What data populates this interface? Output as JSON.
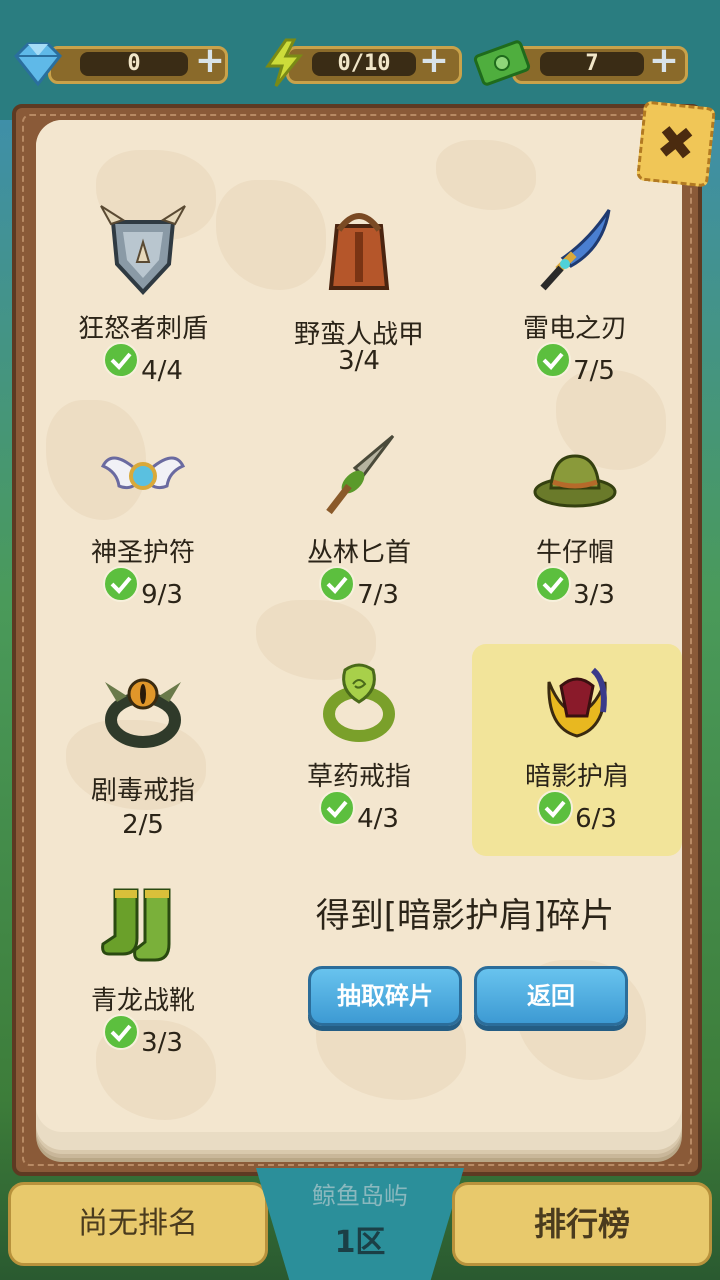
{
  "resources": [
    {
      "name": "diamond",
      "value": "0",
      "icon": "diamond-icon"
    },
    {
      "name": "energy",
      "value": "0/10",
      "icon": "lightning-icon"
    },
    {
      "name": "cash",
      "value": "7",
      "icon": "cash-icon"
    }
  ],
  "close_label": "✖",
  "items": [
    {
      "name": "狂怒者刺盾",
      "count": "4/4",
      "checked": true,
      "icon": "spiked-shield-icon"
    },
    {
      "name": "野蛮人战甲",
      "count": "3/4",
      "checked": false,
      "icon": "leather-armor-icon"
    },
    {
      "name": "雷电之刃",
      "count": "7/5",
      "checked": true,
      "icon": "blue-sword-icon"
    },
    {
      "name": "神圣护符",
      "count": "9/3",
      "checked": true,
      "icon": "winged-amulet-icon"
    },
    {
      "name": "丛林匕首",
      "count": "7/3",
      "checked": true,
      "icon": "jungle-dagger-icon"
    },
    {
      "name": "牛仔帽",
      "count": "3/3",
      "checked": true,
      "icon": "cowboy-hat-icon"
    },
    {
      "name": "剧毒戒指",
      "count": "2/5",
      "checked": false,
      "icon": "eye-ring-icon"
    },
    {
      "name": "草药戒指",
      "count": "4/3",
      "checked": true,
      "icon": "herb-ring-icon"
    },
    {
      "name": "暗影护肩",
      "count": "6/3",
      "checked": true,
      "icon": "shoulder-pad-icon",
      "selected": true
    },
    {
      "name": "青龙战靴",
      "count": "3/3",
      "checked": true,
      "icon": "green-boots-icon"
    }
  ],
  "notice": "得到[暗影护肩]碎片",
  "buttons": {
    "draw": "抽取碎片",
    "back": "返回"
  },
  "bottom": {
    "rank": "尚无排名",
    "server": "鲸鱼岛屿",
    "zone": "1区",
    "leaderboard": "排行榜"
  },
  "colors": {
    "check": "#5cbf3e",
    "button": "#4aa8dd",
    "selected_bg": "#f2e49a",
    "page_bg": "#f3e6cf"
  }
}
